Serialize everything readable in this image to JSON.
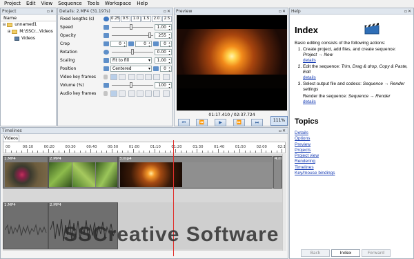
{
  "menu": [
    "Project",
    "Edit",
    "View",
    "Sequence",
    "Tools",
    "Workspace",
    "Help"
  ],
  "project": {
    "title": "Project",
    "column": "Name",
    "items": [
      "unnamed1",
      "M:\\SSCr...Videos",
      "Videos"
    ]
  },
  "details": {
    "title": "Details: 2.MP4 (31.197s)",
    "fixed_lengths_label": "Fixed lengths (s)",
    "fixed_lengths": [
      "0.25",
      "0.5",
      "1.0",
      "1.5",
      "2.0",
      "2.5"
    ],
    "speed_label": "Speed",
    "speed_value": "1.00",
    "opacity_label": "Opacity",
    "opacity_value": "255",
    "crop_label": "Crop",
    "crop_values": [
      "0",
      "0",
      "0"
    ],
    "rotation_label": "Rotation",
    "rotation_value": "0.00",
    "scaling_label": "Scaling",
    "scaling_mode": "Fit to fill",
    "scaling_value": "1.00",
    "position_label": "Position",
    "position_mode": "Centered",
    "position_value": "0",
    "video_kf_label": "Video key frames",
    "volume_label": "Volume (%)",
    "volume_value": "100",
    "audio_kf_label": "Audio key frames"
  },
  "preview": {
    "title": "Preview",
    "time": "01:17.410 / 02:37.724",
    "zoom": "111%",
    "transport": [
      "⏮",
      "⏪",
      "▶",
      "⏩",
      "⏭"
    ]
  },
  "help": {
    "title": "Help",
    "heading": "Index",
    "intro": "Basic editing consists of the following actions:",
    "steps": [
      {
        "text": "Create project, add files, and create sequence: ",
        "em": "Project → New",
        "link": "details"
      },
      {
        "text": "Edit the sequence: ",
        "em": "Trim, Drag & drop, Copy & Paste, Edit",
        "link": "details"
      },
      {
        "text": "Select output file and codecs: ",
        "em": "Sequence → Render settings",
        "link": ""
      }
    ],
    "render_text": "Render the sequence: ",
    "render_em": "Sequence → Render",
    "render_link": "details",
    "topics_heading": "Topics",
    "topics": [
      "Details",
      "Options",
      "Preview",
      "Projects",
      "Project view",
      "Rendering",
      "Timelines",
      "Key/mouse bindings"
    ],
    "nav": [
      "Back",
      "Index",
      "Forward"
    ]
  },
  "timelines": {
    "title": "Timelines",
    "tab": "Videos",
    "ticks": [
      "00",
      "00:10",
      "00:20",
      "00:30",
      "00:40",
      "00:50",
      "01:00",
      "01:10",
      "01:20",
      "01:30",
      "01:40",
      "01:50",
      "02:00",
      "02:10",
      "02:20",
      "02:30"
    ],
    "video_clips": [
      "1.MP4",
      "2.MP4",
      "3.mp4",
      "4.m"
    ],
    "audio_clips": [
      "1.MP4",
      "2.MP4"
    ]
  },
  "watermark": "SSCreative Software"
}
